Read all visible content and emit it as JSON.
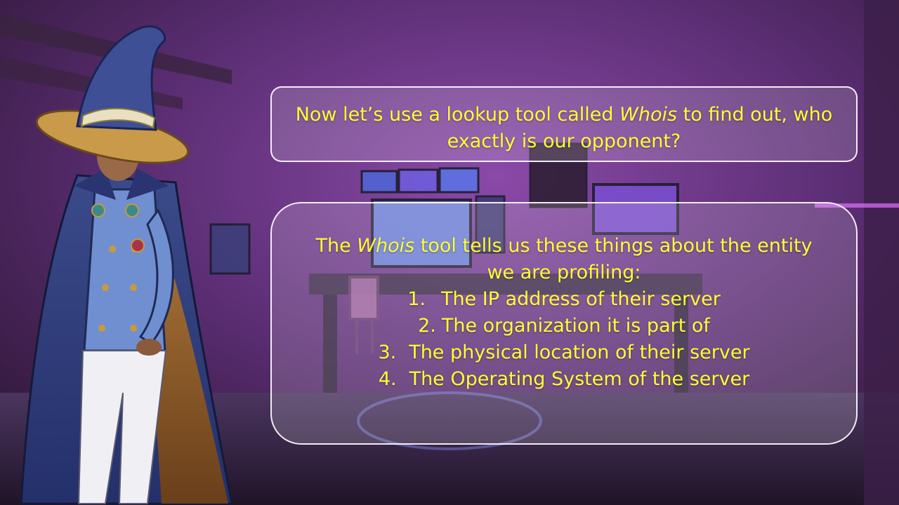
{
  "dialog_top": {
    "prefix": "Now let’s use a lookup tool called ",
    "tool_name": "Whois",
    "suffix": " to find out, who exactly is our opponent?"
  },
  "dialog_main": {
    "intro_prefix": "The ",
    "tool_name": "Whois",
    "intro_suffix": " tool tells us these things about the entity we are profiling:",
    "items": [
      {
        "num": "1.",
        "text": "The IP address of their server"
      },
      {
        "num": "2.",
        "text": "The organization it is part of"
      },
      {
        "num": "3.",
        "text": "The physical location of their server"
      },
      {
        "num": "4.",
        "text": "The Operating System of the server"
      }
    ]
  },
  "colors": {
    "text": "#ffff33",
    "bubble_border": "#ffffff",
    "background_glow": "#c04ad0"
  }
}
